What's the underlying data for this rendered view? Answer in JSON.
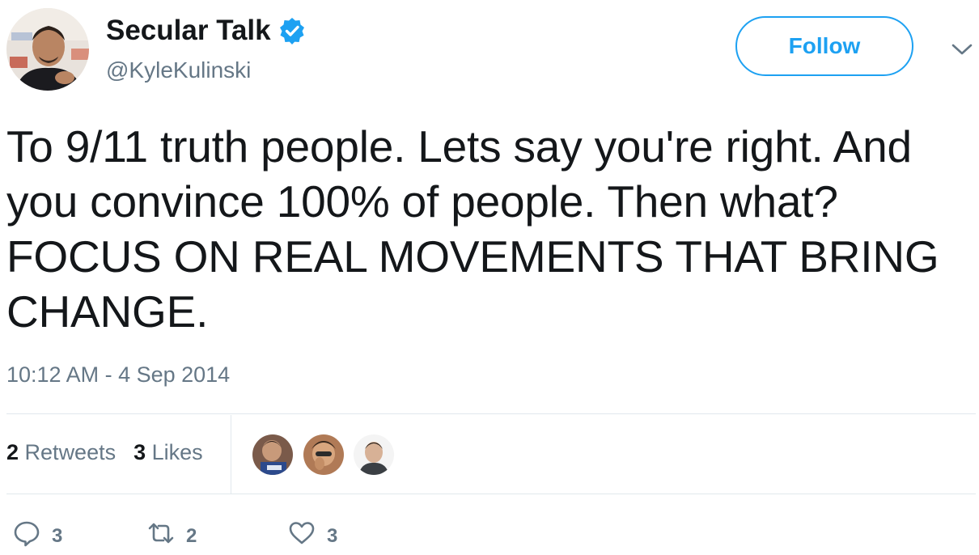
{
  "author": {
    "display_name": "Secular Talk",
    "handle": "@KyleKulinski",
    "verified": true
  },
  "follow_button": {
    "label": "Follow"
  },
  "tweet": {
    "text": "To 9/11 truth people. Lets say you're right. And you convince 100% of people. Then what? FOCUS ON REAL MOVEMENTS THAT BRING CHANGE.",
    "timestamp": "10:12 AM - 4 Sep 2014"
  },
  "stats": {
    "retweets_count": "2",
    "retweets_label": "Retweets",
    "likes_count": "3",
    "likes_label": "Likes"
  },
  "actions": {
    "reply_count": "3",
    "retweet_count": "2",
    "like_count": "3"
  },
  "colors": {
    "accent": "#1da1f2",
    "text": "#14171a",
    "secondary": "#657786",
    "border": "#e1e8ed"
  },
  "icons": [
    "verified-badge-icon",
    "chevron-down-icon",
    "reply-icon",
    "retweet-icon",
    "heart-icon"
  ]
}
